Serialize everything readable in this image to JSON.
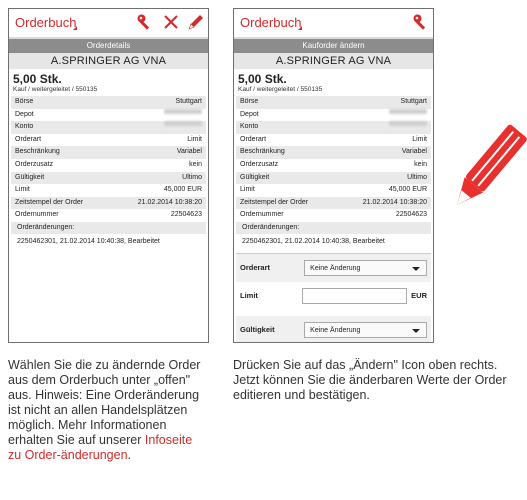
{
  "left_panel": {
    "app_title": "Orderbuch",
    "section_title": "Orderdetails",
    "company": "A.SPRINGER AG VNA",
    "quantity": "5,00 Stk.",
    "subtitle": "Kauf / weitergeleitet / 550135",
    "rows": [
      {
        "label": "Börse",
        "value": "Stuttgart"
      },
      {
        "label": "Depot",
        "value": ""
      },
      {
        "label": "Konto",
        "value": ""
      },
      {
        "label": "Orderart",
        "value": "Limit"
      },
      {
        "label": "Beschränkung",
        "value": "Variabel"
      },
      {
        "label": "Orderzusatz",
        "value": "kein"
      },
      {
        "label": "Gültigkeit",
        "value": "Ultimo"
      },
      {
        "label": "Limit",
        "value": "45,000 EUR"
      },
      {
        "label": "Zeitstempel der Order",
        "value": "21.02.2014 10:38:20"
      },
      {
        "label": "Ordernummer",
        "value": "22504623"
      }
    ],
    "history_header": "Orderänderungen:",
    "history_value": "2250462301, 21.02.2014 10:40:38, Bearbeitet"
  },
  "right_panel": {
    "app_title": "Orderbuch",
    "section_title": "Kauforder ändern",
    "company": "A.SPRINGER AG VNA",
    "quantity": "5,00 Stk.",
    "subtitle": "Kauf / weitergeleitet / 550135",
    "rows": [
      {
        "label": "Börse",
        "value": "Stuttgart"
      },
      {
        "label": "Depot",
        "value": ""
      },
      {
        "label": "Konto",
        "value": ""
      },
      {
        "label": "Orderart",
        "value": "Limit"
      },
      {
        "label": "Beschränkung",
        "value": "Variabel"
      },
      {
        "label": "Orderzusatz",
        "value": "kein"
      },
      {
        "label": "Gültigkeit",
        "value": "Ultimo"
      },
      {
        "label": "Limit",
        "value": "45,000 EUR"
      },
      {
        "label": "Zeitstempel der Order",
        "value": "21.02.2014 10:38:20"
      },
      {
        "label": "Ordernummer",
        "value": "22504623"
      }
    ],
    "history_header": "Orderänderungen:",
    "history_value": "2250462301, 21.02.2014 10:40:38, Bearbeitet",
    "form": {
      "orderart_label": "Orderart",
      "orderart_value": "Keine Änderung",
      "limit_label": "Limit",
      "limit_unit": "EUR",
      "gueltigkeit_label": "Gültigkeit",
      "gueltigkeit_value": "Keine Änderung"
    }
  },
  "captions": {
    "left_text": "Wählen Sie die zu ändernde Order aus dem Orderbuch unter „offen\" aus. Hinweis: Eine Orderänderung ist nicht an allen Handelsplätzen möglich. Mehr Informationen erhalten Sie auf unserer ",
    "left_link": "Infoseite zu Order-änderungen",
    "left_end": ".",
    "right_text": "Drücken Sie auf das „Ändern\" Icon oben rechts. Jetzt können Sie die änderbaren Werte der Order editieren und bestätigen."
  },
  "colors": {
    "accent": "#d62a2a",
    "header_gray": "#8c8c8c",
    "row_shade": "#e9e9e9"
  }
}
